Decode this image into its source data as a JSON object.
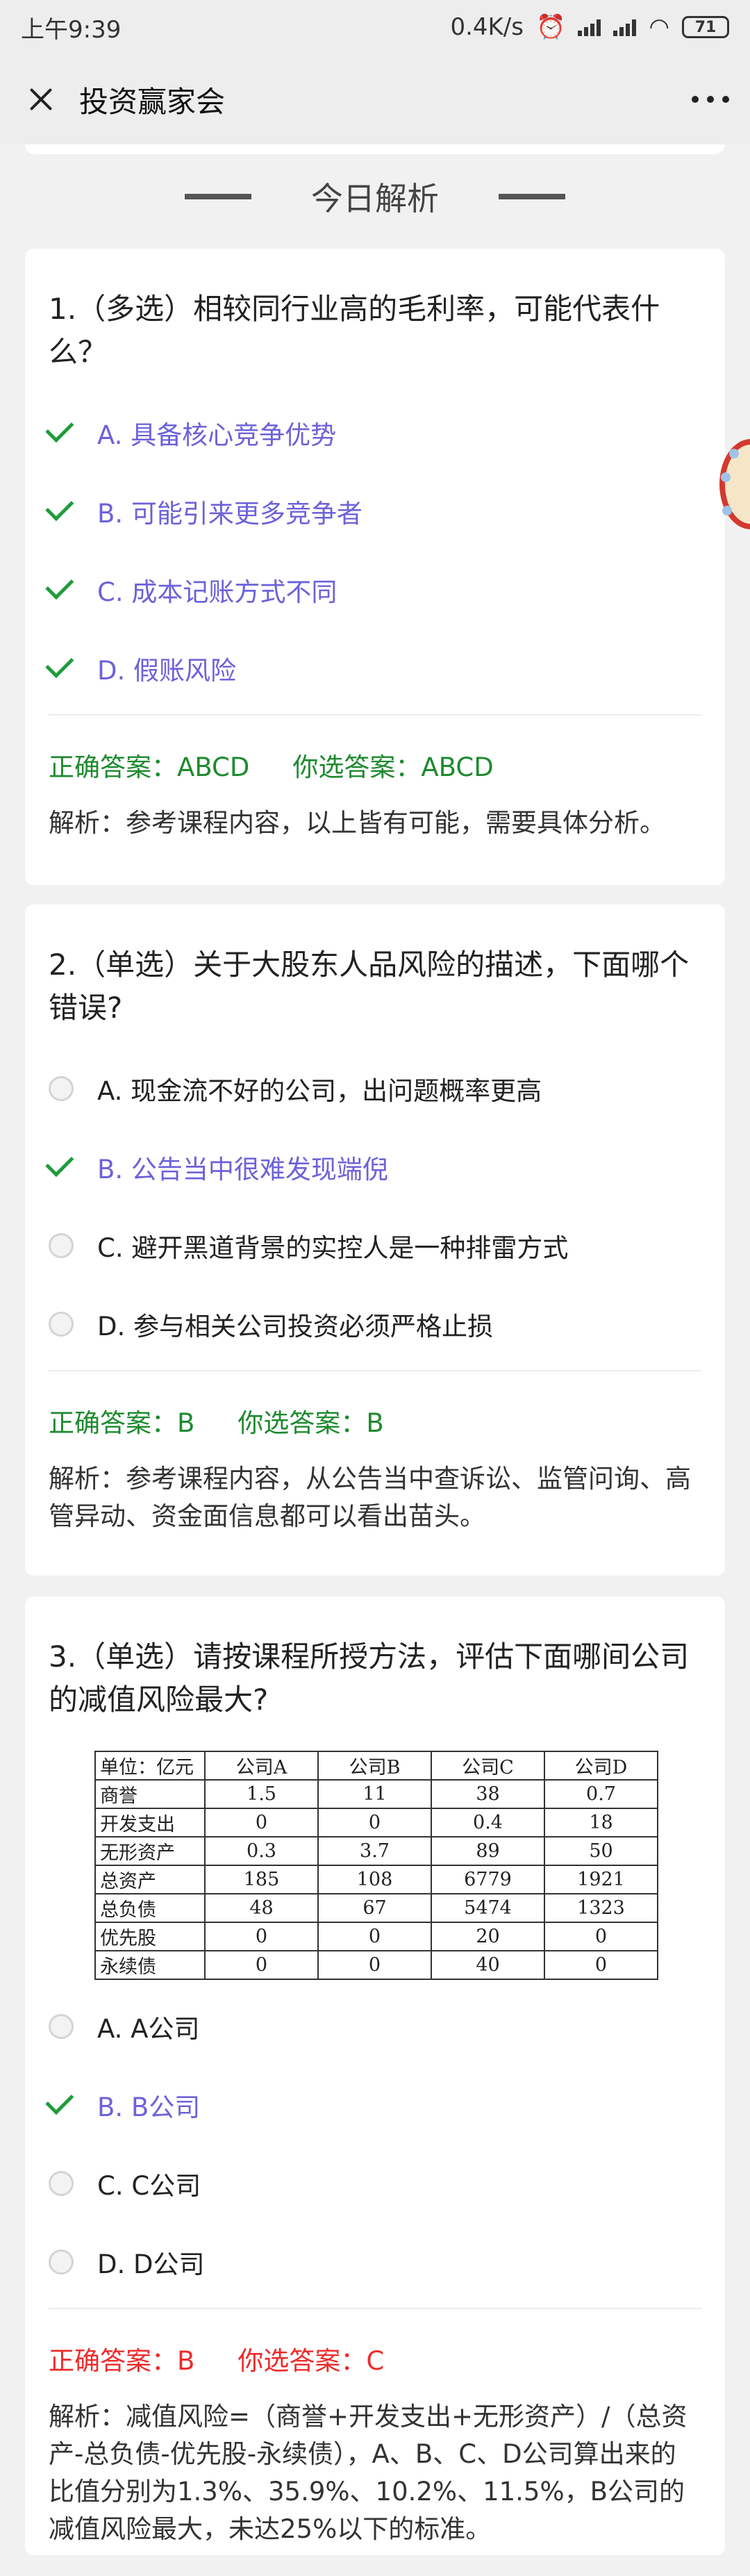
{
  "status_bar": {
    "time": "上午9:39",
    "speed": "0.4K/s",
    "battery": "71"
  },
  "nav": {
    "title": "投资赢家会"
  },
  "section_title": "今日解析",
  "questions": [
    {
      "question": "1.（多选）相较同行业高的毛利率，可能代表什么？",
      "options": [
        {
          "label": "A. 具备核心竞争优势"
        },
        {
          "label": "B. 可能引来更多竞争者"
        },
        {
          "label": "C. 成本记账方式不同"
        },
        {
          "label": "D. 假账风险"
        }
      ],
      "correct": "正确答案：ABCD",
      "chosen": "你选答案：ABCD",
      "analysis": "解析：参考课程内容，以上皆有可能，需要具体分析。"
    },
    {
      "question": "2.（单选）关于大股东人品风险的描述，下面哪个错误?",
      "options": [
        {
          "label": "A. 现金流不好的公司，出问题概率更高"
        },
        {
          "label": "B. 公告当中很难发现端倪"
        },
        {
          "label": "C. 避开黑道背景的实控人是一种排雷方式"
        },
        {
          "label": "D. 参与相关公司投资必须严格止损"
        }
      ],
      "correct": "正确答案：B",
      "chosen": "你选答案：B",
      "analysis": "解析：参考课程内容，从公告当中查诉讼、监管问询、高管异动、资金面信息都可以看出苗头。"
    },
    {
      "question": "3.（单选）请按课程所授方法，评估下面哪间公司的减值风险最大?",
      "table": {
        "headers": [
          "单位：亿元",
          "公司A",
          "公司B",
          "公司C",
          "公司D"
        ],
        "rows": [
          [
            "商誉",
            "1.5",
            "11",
            "38",
            "0.7"
          ],
          [
            "开发支出",
            "0",
            "0",
            "0.4",
            "18"
          ],
          [
            "无形资产",
            "0.3",
            "3.7",
            "89",
            "50"
          ],
          [
            "总资产",
            "185",
            "108",
            "6779",
            "1921"
          ],
          [
            "总负债",
            "48",
            "67",
            "5474",
            "1323"
          ],
          [
            "优先股",
            "0",
            "0",
            "20",
            "0"
          ],
          [
            "永续债",
            "0",
            "0",
            "40",
            "0"
          ]
        ]
      },
      "options": [
        {
          "label": "A. A公司"
        },
        {
          "label": "B. B公司"
        },
        {
          "label": "C. C公司"
        },
        {
          "label": "D. D公司"
        }
      ],
      "correct": "正确答案：B",
      "chosen": "你选答案：C",
      "analysis": "解析：减值风险=（商誉+开发支出+无形资产）/（总资产-总负债-优先股-永续债），A、B、C、D公司算出来的比值分别为1.3%、35.9%、10.2%、11.5%，B公司的减值风险最大，未达25%以下的标准。"
    }
  ],
  "colors": {
    "correct_green": "#1e8a2f",
    "wrong_red": "#ee2b2b",
    "selected_purple": "#6c62d9"
  },
  "icons": [
    "wifi-icon",
    "signal-icon",
    "alarm-icon",
    "close-icon",
    "more-icon",
    "check-icon",
    "radio-icon"
  ]
}
